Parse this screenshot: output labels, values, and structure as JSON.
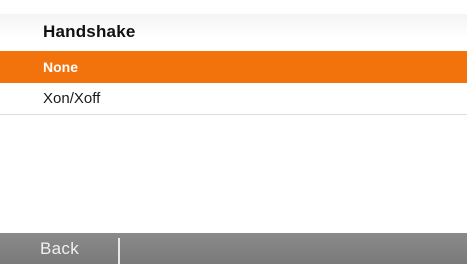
{
  "header": {
    "title": "Handshake"
  },
  "list": {
    "items": [
      {
        "label": "None",
        "selected": true
      },
      {
        "label": "Xon/Xoff",
        "selected": false
      }
    ]
  },
  "softkeys": {
    "left_label": "Back"
  },
  "colors": {
    "selection": "#f2720c",
    "softkey_bar": "#808080",
    "background": "#ffffff"
  }
}
